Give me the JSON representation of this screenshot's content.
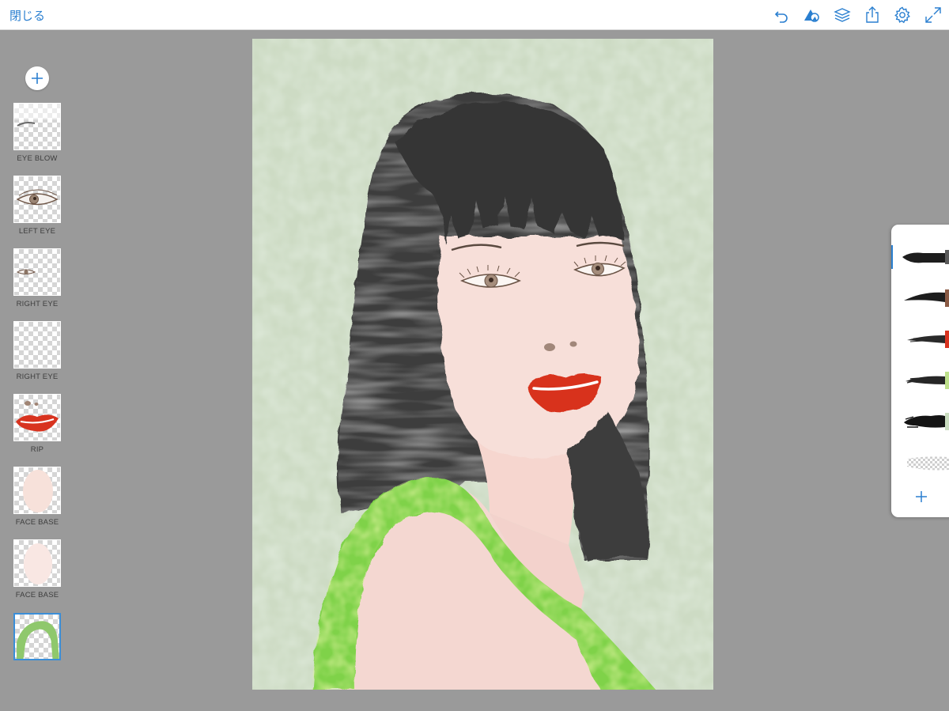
{
  "topbar": {
    "close_label": "閉じる",
    "tools": [
      "undo-icon",
      "shapes-icon",
      "layers-icon",
      "share-icon",
      "settings-icon",
      "fullscreen-icon"
    ]
  },
  "layers_panel": {
    "add_icon": "plus-icon",
    "layers": [
      {
        "label": "EYE BLOW",
        "selected": false
      },
      {
        "label": "LEFT EYE",
        "selected": false
      },
      {
        "label": "RIGHT EYE",
        "selected": false
      },
      {
        "label": "RIGHT EYE",
        "selected": false
      },
      {
        "label": "RIP",
        "selected": false
      },
      {
        "label": "FACE BASE",
        "selected": false
      },
      {
        "label": "FACE BASE",
        "selected": false
      },
      {
        "label": "",
        "selected": true
      }
    ]
  },
  "brushes_panel": {
    "brushes": [
      {
        "color": "#5a5a5a",
        "active": true
      },
      {
        "color": "#8a5a44",
        "active": false
      },
      {
        "color": "#d8331f",
        "active": false
      },
      {
        "color": "#bde08a",
        "active": false
      },
      {
        "color": "#c9dcbf",
        "active": false
      },
      {
        "color": "#bdbdbd",
        "active": false
      }
    ],
    "add_icon": "plus-icon"
  },
  "colors": {
    "accent": "#2a7fd0",
    "canvas_bg": "#cfdcc6",
    "hair": "#3c3c3c",
    "skin": "#f6dcd6",
    "lips": "#d8331f",
    "dress": "#7fd24a"
  }
}
